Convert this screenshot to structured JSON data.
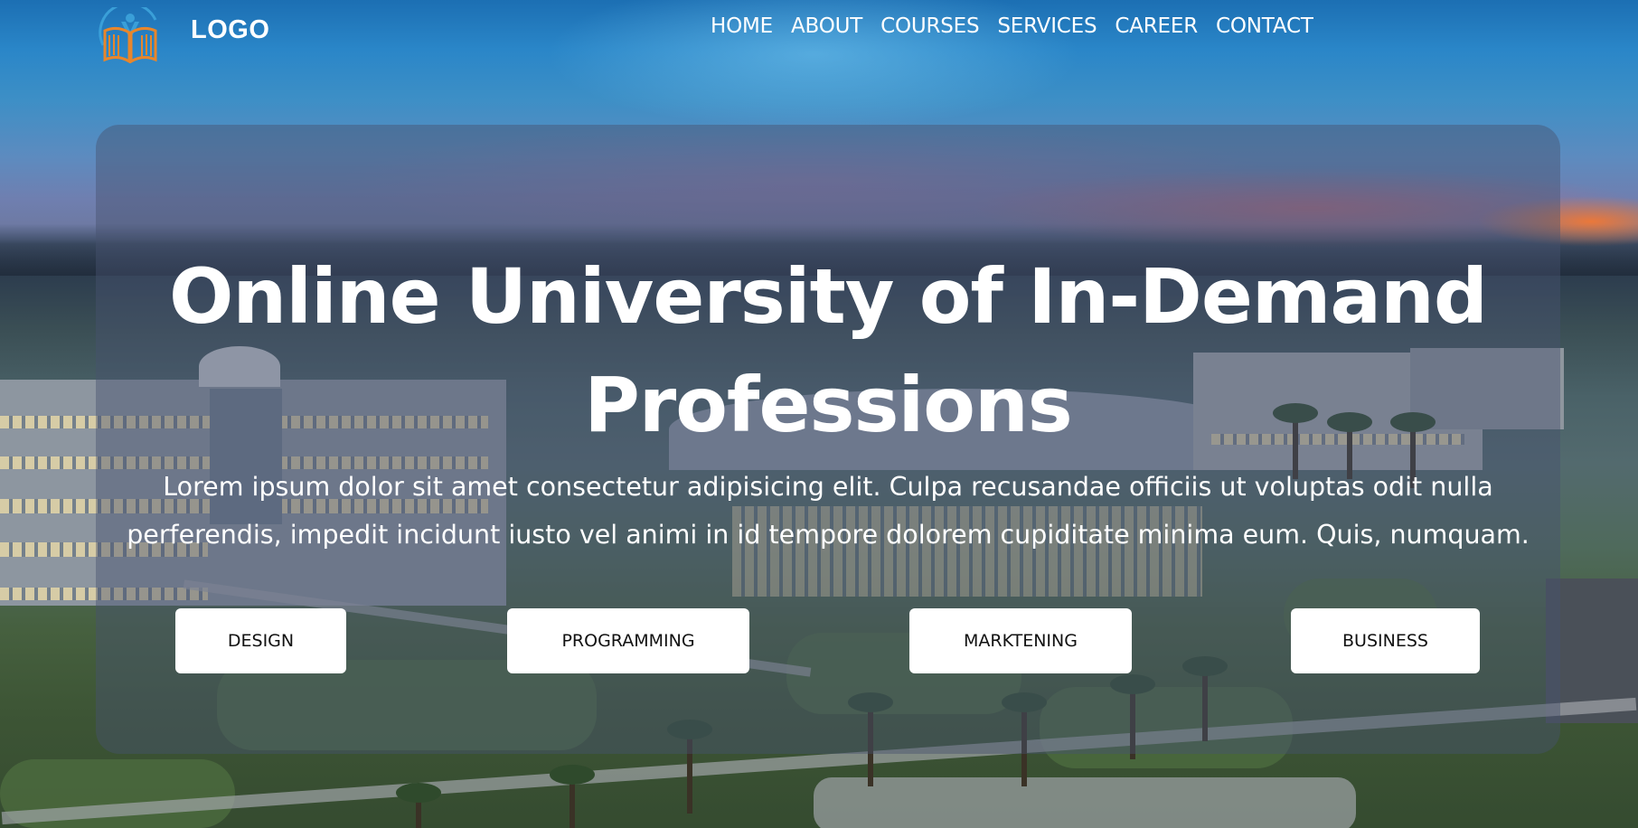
{
  "header": {
    "logo_text": "LOGO",
    "nav": [
      {
        "label": "HOME"
      },
      {
        "label": "ABOUT"
      },
      {
        "label": "COURSES"
      },
      {
        "label": "SERVICES"
      },
      {
        "label": "CAREER"
      },
      {
        "label": "CONTACT"
      }
    ]
  },
  "hero": {
    "title_line1": "Online University of In-Demand",
    "title_line2": "Professions",
    "subtitle_line1": "Lorem ipsum dolor sit amet consectetur adipisicing elit. Culpa recusandae officiis ut voluptas odit nulla",
    "subtitle_line2": "perferendis, impedit incidunt iusto vel animi in id tempore dolorem cupiditate minima eum. Quis, numquam.",
    "buttons": [
      {
        "label": "DESIGN"
      },
      {
        "label": "PROGRAMMING"
      },
      {
        "label": "MARKTENING"
      },
      {
        "label": "BUSINESS"
      }
    ]
  },
  "colors": {
    "text": "#ffffff",
    "button_bg": "#ffffff",
    "button_text": "#111111",
    "panel_tint": "#46526e",
    "logo_blue": "#3a9fd8",
    "logo_orange": "#e8862b"
  },
  "icons": {
    "logo": "open-book-with-person-icon"
  }
}
